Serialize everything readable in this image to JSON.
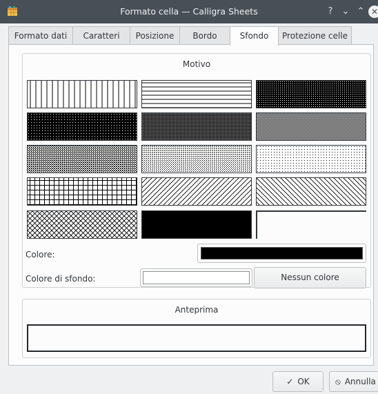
{
  "window": {
    "title": "Formato cella — Calligra Sheets",
    "help_symbol": "?",
    "minimize_symbol": "⌄",
    "maximize_symbol": "⌃",
    "close_symbol": "✕"
  },
  "tabs": [
    {
      "label": "Formato dati",
      "active": false
    },
    {
      "label": "Caratteri",
      "active": false
    },
    {
      "label": "Posizione",
      "active": false
    },
    {
      "label": "Bordo",
      "active": false
    },
    {
      "label": "Sfondo",
      "active": true
    },
    {
      "label": "Protezione celle",
      "active": false
    }
  ],
  "motivo": {
    "title": "Motivo",
    "patterns": [
      {
        "name": "vertical-lines",
        "selected": false
      },
      {
        "name": "horizontal-lines",
        "selected": false
      },
      {
        "name": "dense-1",
        "selected": false
      },
      {
        "name": "dense-2",
        "selected": false
      },
      {
        "name": "dense-3",
        "selected": false
      },
      {
        "name": "dense-4",
        "selected": false
      },
      {
        "name": "dense-5",
        "selected": false
      },
      {
        "name": "dense-6",
        "selected": false
      },
      {
        "name": "dense-7",
        "selected": false
      },
      {
        "name": "cross-grid",
        "selected": false
      },
      {
        "name": "forward-diagonal",
        "selected": false
      },
      {
        "name": "backward-diagonal",
        "selected": false
      },
      {
        "name": "diagonal-cross",
        "selected": false
      },
      {
        "name": "solid",
        "selected": false
      },
      {
        "name": "no-brush",
        "selected": true
      }
    ]
  },
  "colore": {
    "label": "Colore:",
    "value": "#000000"
  },
  "sfondo": {
    "label": "Colore di sfondo:",
    "value": "#ffffff",
    "none_button": "Nessun colore"
  },
  "anteprima": {
    "title": "Anteprima"
  },
  "footer": {
    "ok_label": "OK",
    "cancel_label": "Annulla"
  }
}
